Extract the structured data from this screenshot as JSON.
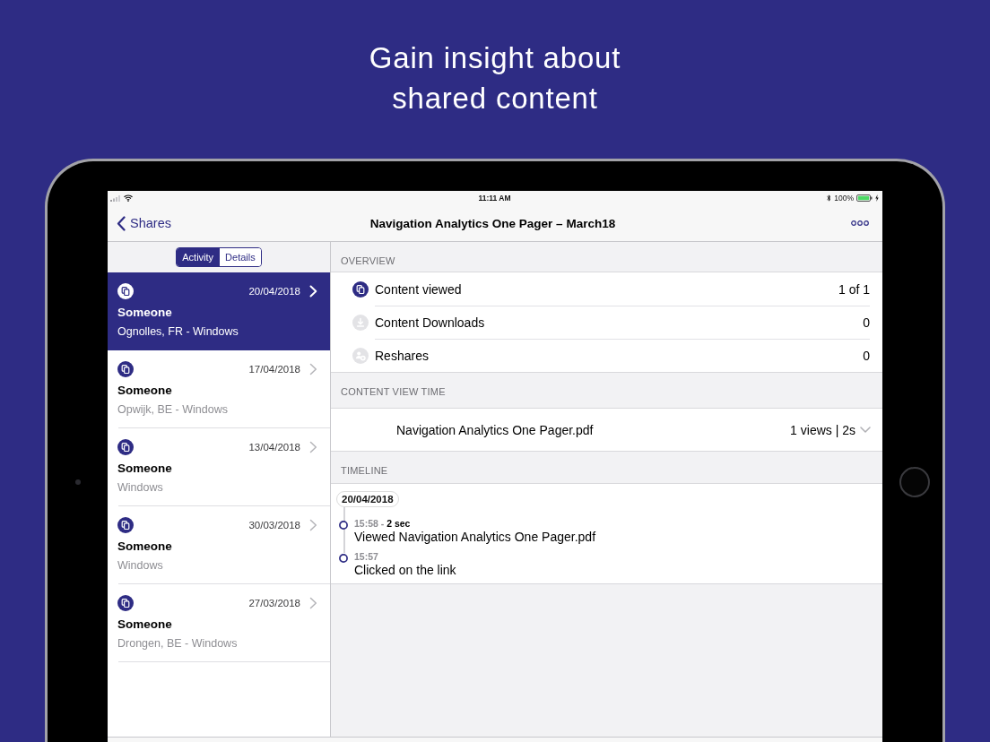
{
  "headline": "Gain insight about\nshared content",
  "status_bar": {
    "time": "11:11 AM",
    "battery_text": "100%"
  },
  "nav_bar": {
    "back": "Shares",
    "title": "Navigation Analytics One Pager – March18"
  },
  "segments": [
    {
      "label": "Activity",
      "selected": true
    },
    {
      "label": "Details",
      "selected": false
    }
  ],
  "shares": [
    {
      "date": "20/04/2018",
      "name": "Someone",
      "location": "Ognolles, FR - Windows",
      "selected": true
    },
    {
      "date": "17/04/2018",
      "name": "Someone",
      "location": "Opwijk, BE - Windows",
      "selected": false
    },
    {
      "date": "13/04/2018",
      "name": "Someone",
      "location": "Windows",
      "selected": false
    },
    {
      "date": "30/03/2018",
      "name": "Someone",
      "location": "Windows",
      "selected": false
    },
    {
      "date": "27/03/2018",
      "name": "Someone",
      "location": "Drongen, BE - Windows",
      "selected": false
    }
  ],
  "overview": {
    "header": "OVERVIEW",
    "items": [
      {
        "kind": "view",
        "label": "Content viewed",
        "value": "1 of 1",
        "active": true
      },
      {
        "kind": "download",
        "label": "Content Downloads",
        "value": "0",
        "active": false
      },
      {
        "kind": "reshare",
        "label": "Reshares",
        "value": "0",
        "active": false
      }
    ]
  },
  "content_view_time": {
    "header": "CONTENT VIEW TIME",
    "rows": [
      {
        "file": "Navigation Analytics One Pager.pdf",
        "summary": "1 views | 2s",
        "expanded": false
      }
    ]
  },
  "timeline": {
    "header": "TIMELINE",
    "date": "20/04/2018",
    "events": [
      {
        "meta": "15:58 - **2 sec**",
        "text": "Viewed Navigation Analytics One Pager.pdf"
      },
      {
        "meta": "15:57",
        "text": "Clicked on the link"
      }
    ]
  }
}
